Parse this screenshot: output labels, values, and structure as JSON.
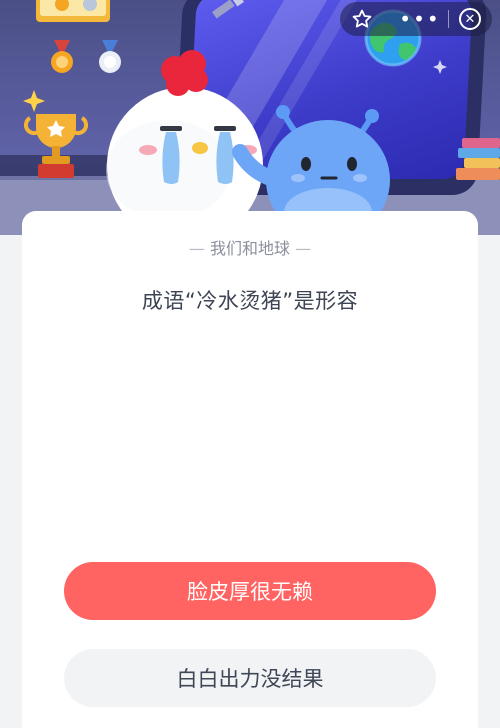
{
  "header": {
    "icons": [
      "medal-gold-icon",
      "medal-silver-icon",
      "medal-orange-icon",
      "medal-white-icon",
      "trophy-icon",
      "satellite-icon",
      "earth-icon",
      "books-icon"
    ]
  },
  "capsule": {
    "favorite_icon": "star-icon",
    "more_label": "•••",
    "close_icon": "close-icon"
  },
  "quiz": {
    "title": "我们和地球",
    "question": "成语“冷水烫猪”是形容",
    "options": [
      {
        "label": "脸皮厚很无赖"
      },
      {
        "label": "白白出力没结果"
      }
    ]
  },
  "colors": {
    "primary_option": "#ff6462",
    "secondary_option": "#f2f3f5",
    "banner": "#5b5fa2"
  }
}
